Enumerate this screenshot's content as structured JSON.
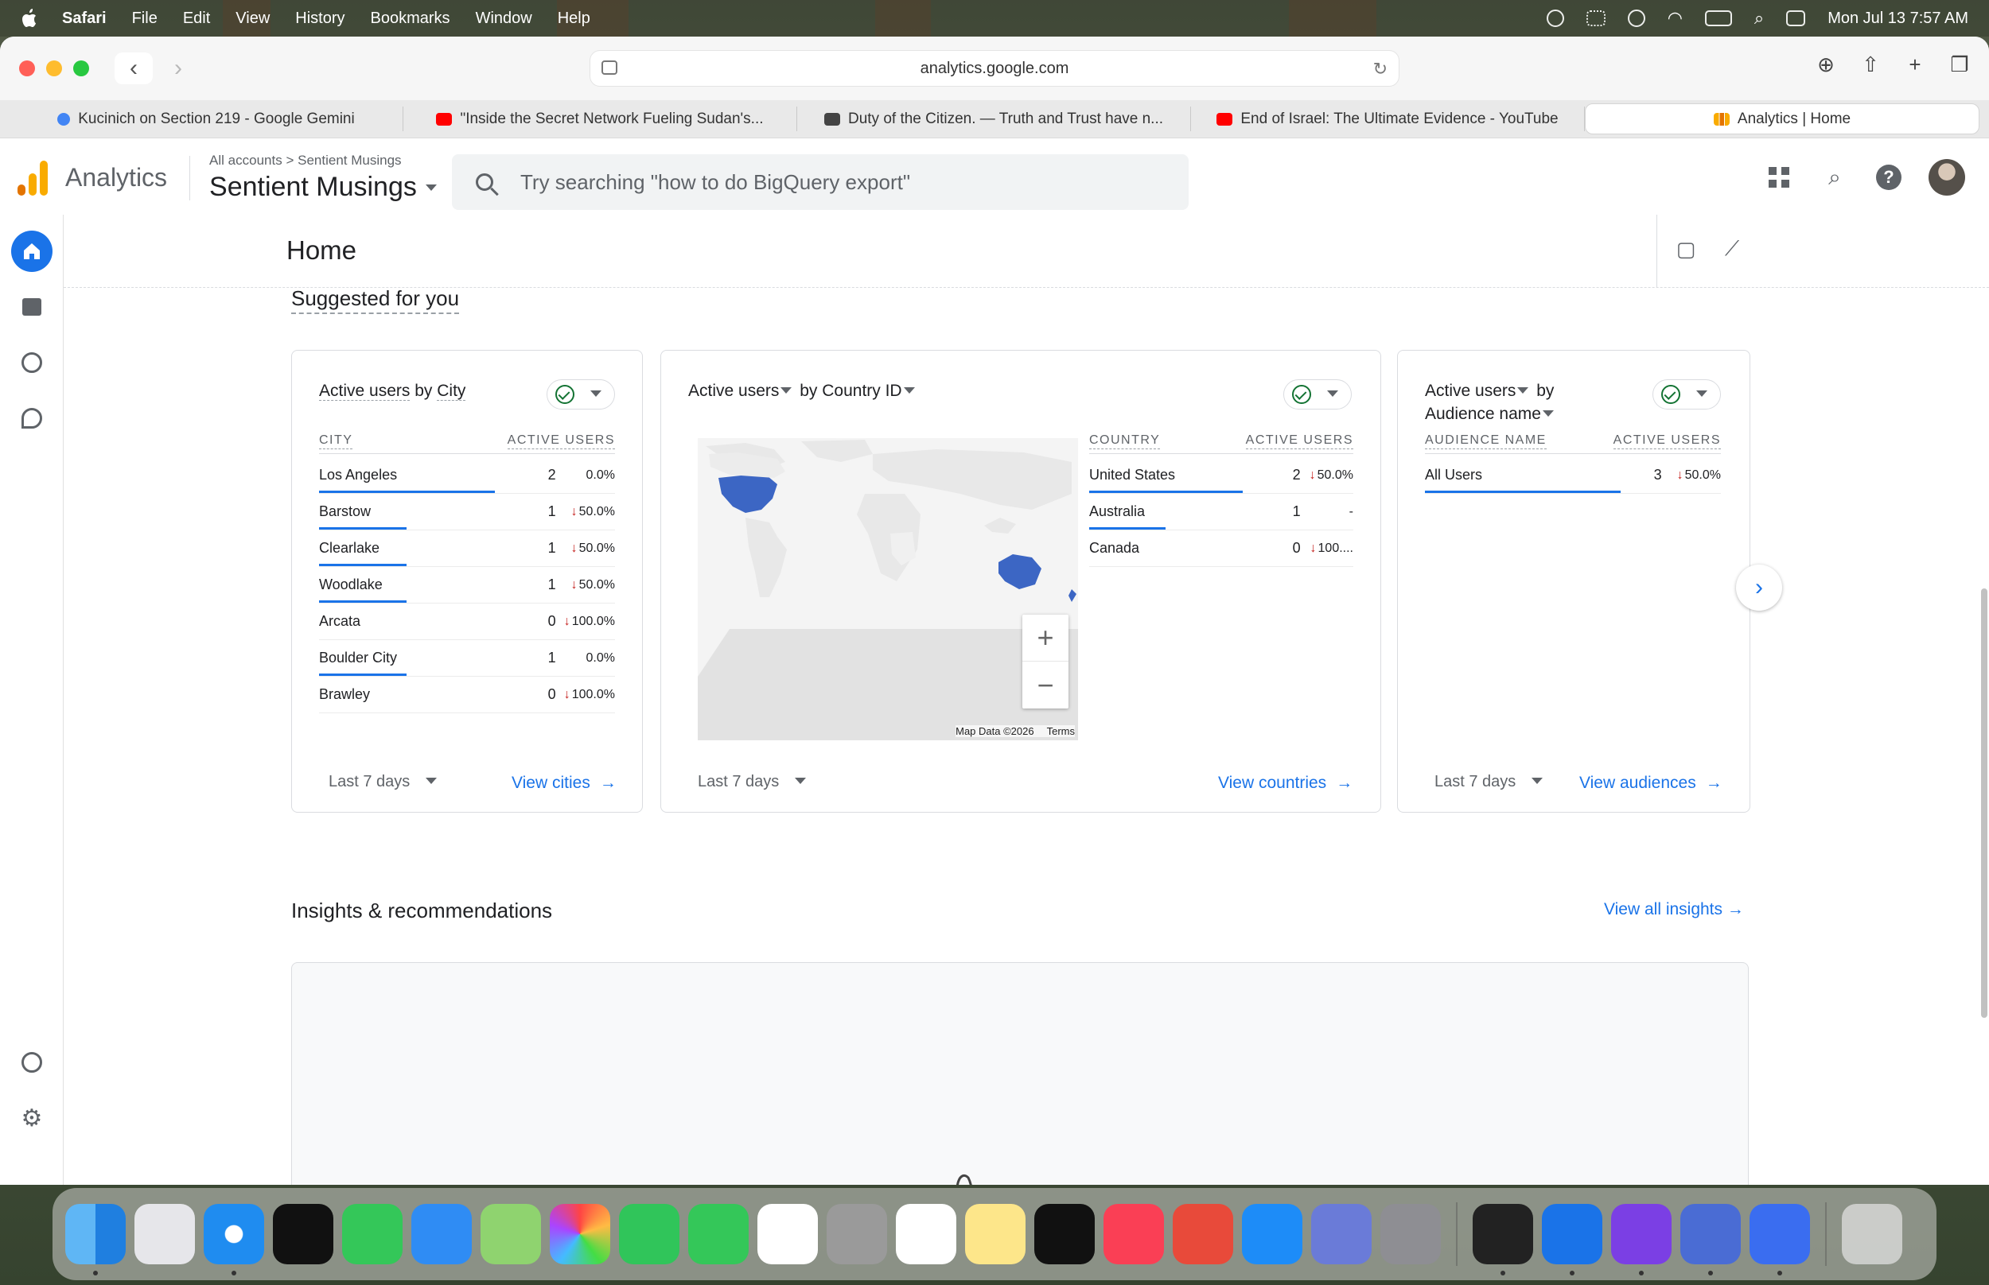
{
  "menubar": {
    "app": "Safari",
    "items": [
      "File",
      "Edit",
      "View",
      "History",
      "Bookmarks",
      "Window",
      "Help"
    ],
    "datetime": "Mon Jul 13  7:57 AM"
  },
  "browser": {
    "url": "analytics.google.com",
    "tabs": [
      {
        "label": "Kucinich on Section 219 - Google Gemini",
        "color": "#4285f4"
      },
      {
        "label": "\"Inside the Secret Network Fueling Sudan's...",
        "color": "#ff0000"
      },
      {
        "label": "Duty of the Citizen. — Truth and Trust have n...",
        "color": "#444444"
      },
      {
        "label": "End of Israel: The Ultimate Evidence - YouTube",
        "color": "#ff0000"
      },
      {
        "label": "Analytics | Home",
        "color": "#f9ab00",
        "active": true
      }
    ]
  },
  "ga": {
    "product": "Analytics",
    "crumb_root": "All accounts",
    "crumb_sep": ">",
    "crumb_account": "Sentient Musings",
    "property": "Sentient Musings",
    "search_placeholder": "Try searching \"how to do BigQuery export\""
  },
  "page": {
    "title": "Home",
    "suggested": "Suggested for you",
    "insights_title": "Insights & recommendations",
    "insights_link": "View all insights"
  },
  "cards": {
    "city": {
      "title_metric": "Active users",
      "title_mid": " by ",
      "title_dim": "City",
      "col1": "CITY",
      "col2": "ACTIVE USERS",
      "footer": "Last 7 days",
      "link": "View cities",
      "rows": [
        {
          "name": "Los Angeles",
          "value": "2",
          "change": "0.0%",
          "down": false,
          "share": 0.9
        },
        {
          "name": "Barstow",
          "value": "1",
          "change": "50.0%",
          "down": true,
          "share": 0.45
        },
        {
          "name": "Clearlake",
          "value": "1",
          "change": "50.0%",
          "down": true,
          "share": 0.45
        },
        {
          "name": "Woodlake",
          "value": "1",
          "change": "50.0%",
          "down": true,
          "share": 0.45
        },
        {
          "name": "Arcata",
          "value": "0",
          "change": "100.0%",
          "down": true,
          "share": 0
        },
        {
          "name": "Boulder City",
          "value": "1",
          "change": "0.0%",
          "down": false,
          "share": 0.45
        },
        {
          "name": "Brawley",
          "value": "0",
          "change": "100.0%",
          "down": true,
          "share": 0
        }
      ]
    },
    "country": {
      "title_metric": "Active users",
      "title_mid": " by ",
      "title_dim": "Country ID",
      "col1": "COUNTRY",
      "col2": "ACTIVE USERS",
      "footer": "Last 7 days",
      "link": "View countries",
      "map_data": "Map Data ©2026",
      "map_terms": "Terms",
      "rows": [
        {
          "name": "United States",
          "value": "2",
          "change": "50.0%",
          "down": true,
          "share": 0.88
        },
        {
          "name": "Australia",
          "value": "1",
          "change": "-",
          "down": false,
          "share": 0.44
        },
        {
          "name": "Canada",
          "value": "0",
          "change": "100....",
          "down": true,
          "share": 0
        }
      ]
    },
    "audience": {
      "title_metric": "Active users",
      "title_mid": " by",
      "title_dim": "Audience name",
      "col1": "AUDIENCE NAME",
      "col2": "ACTIVE USERS",
      "footer": "Last 7 days",
      "link": "View audiences",
      "rows": [
        {
          "name": "All Users",
          "value": "3",
          "change": "50.0%",
          "down": true,
          "share": 1.0
        }
      ]
    }
  },
  "colors": {
    "accent": "#1a73e8",
    "decrease": "#c5221f",
    "ok": "#137333",
    "map_highlight": "#3c66c4"
  }
}
